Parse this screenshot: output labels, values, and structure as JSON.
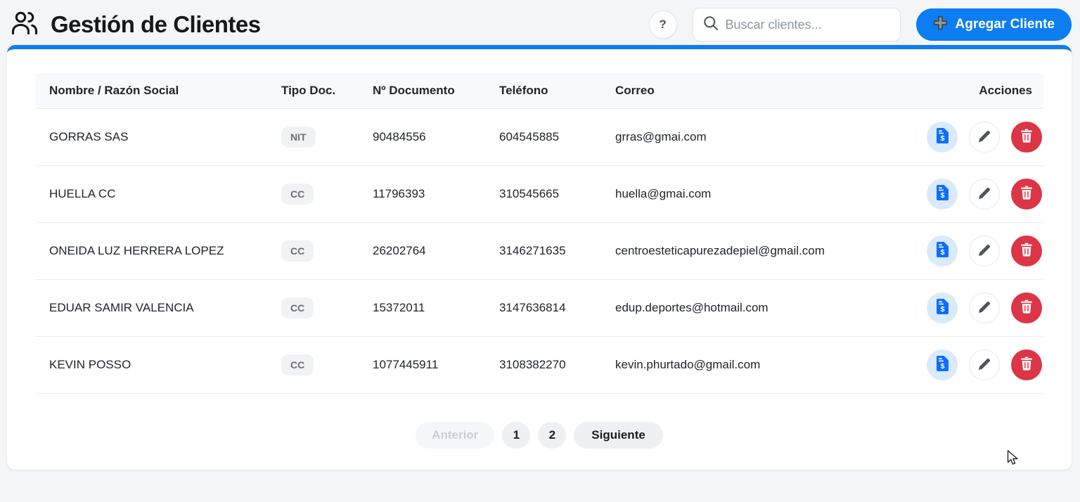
{
  "header": {
    "title": "Gestión de Clientes",
    "help_label": "?",
    "search_placeholder": "Buscar clientes...",
    "add_button_label": "Agregar Cliente"
  },
  "colors": {
    "accent_blue": "#0d7df2",
    "danger_red": "#dc3545",
    "invoice_icon_blue": "#0d6efd",
    "badge_bg": "#f1f2f4"
  },
  "icons": {
    "app": "people-icon",
    "help": "question-mark-icon",
    "search": "magnifier-icon",
    "add": "plus-icon",
    "row_actions": [
      "invoice-dollar-icon",
      "pencil-icon",
      "trash-icon"
    ]
  },
  "table": {
    "columns": [
      "Nombre / Razón Social",
      "Tipo Doc.",
      "Nº Documento",
      "Teléfono",
      "Correo",
      "Acciones"
    ],
    "rows": [
      {
        "name": "GORRAS SAS",
        "doc_type": "NIT",
        "doc_number": "90484556",
        "phone": "604545885",
        "email": "grras@gmai.com"
      },
      {
        "name": "HUELLA CC",
        "doc_type": "CC",
        "doc_number": "11796393",
        "phone": "310545665",
        "email": "huella@gmai.com"
      },
      {
        "name": "ONEIDA LUZ HERRERA LOPEZ",
        "doc_type": "CC",
        "doc_number": "26202764",
        "phone": "3146271635",
        "email": "centroesteticapurezadepiel@gmail.com"
      },
      {
        "name": "EDUAR SAMIR VALENCIA",
        "doc_type": "CC",
        "doc_number": "15372011",
        "phone": "3147636814",
        "email": "edup.deportes@hotmail.com"
      },
      {
        "name": "KEVIN POSSO",
        "doc_type": "CC",
        "doc_number": "1077445911",
        "phone": "3108382270",
        "email": "kevin.phurtado@gmail.com"
      }
    ]
  },
  "pagination": {
    "previous_label": "Anterior",
    "pages": [
      "1",
      "2"
    ],
    "next_label": "Siguiente"
  }
}
